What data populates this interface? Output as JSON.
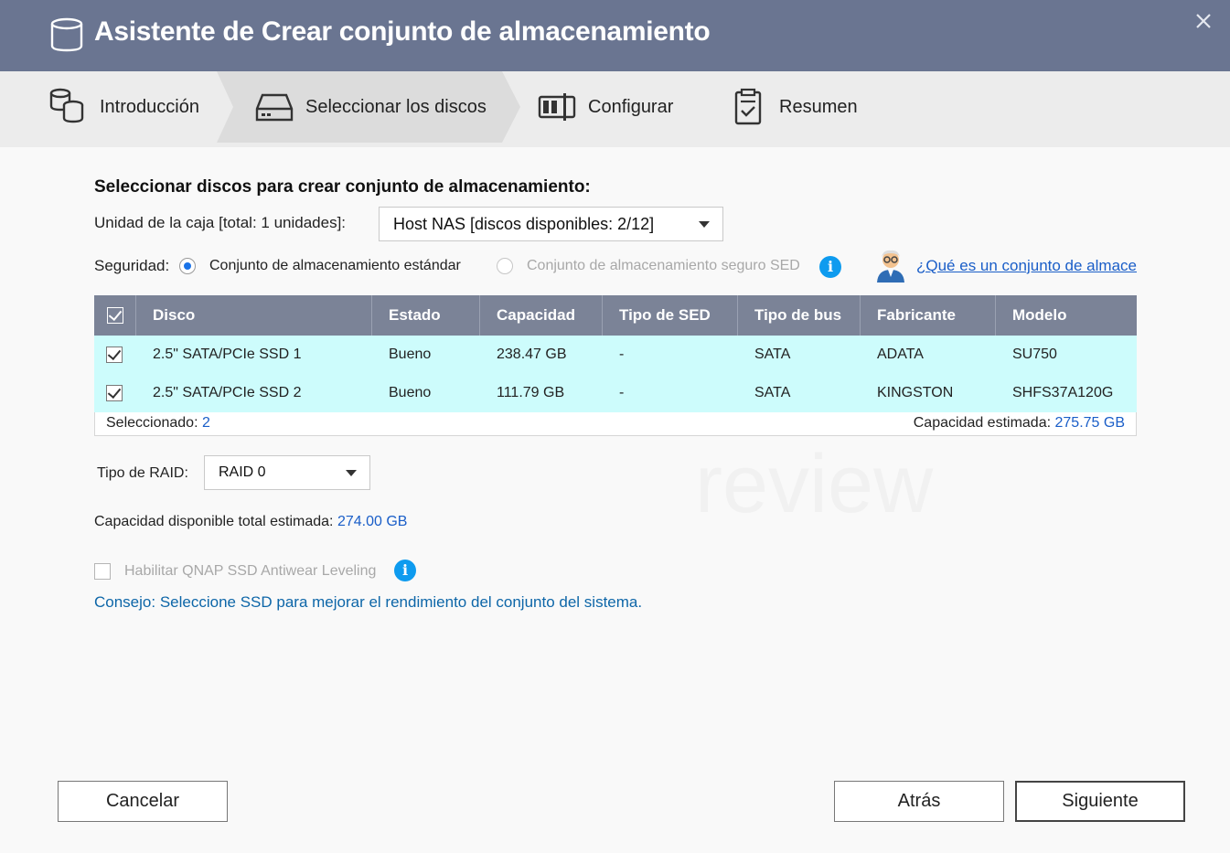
{
  "window": {
    "title": "Asistente de Crear conjunto de almacenamiento",
    "close_icon": "close-icon"
  },
  "steps": [
    {
      "label": "Introducción",
      "icon": "disks-icon"
    },
    {
      "label": "Seleccionar los discos",
      "icon": "drive-icon"
    },
    {
      "label": "Configurar",
      "icon": "config-icon"
    },
    {
      "label": "Resumen",
      "icon": "clipboard-icon"
    }
  ],
  "active_step": 1,
  "section": {
    "heading": "Seleccionar discos para crear conjunto de almacenamiento:",
    "enclosure_label": "Unidad de la caja [total: 1 unidades]:",
    "enclosure_value": "Host NAS [discos disponibles: 2/12]",
    "security_label": "Seguridad:",
    "security_option_standard": "Conjunto de almacenamiento estándar",
    "security_option_sed": "Conjunto de almacenamiento seguro SED",
    "help_link": "¿Qué es un conjunto de almacenamiento SED?"
  },
  "table": {
    "columns": [
      "Disco",
      "Estado",
      "Capacidad",
      "Tipo de SED",
      "Tipo de bus",
      "Fabricante",
      "Modelo"
    ],
    "rows": [
      [
        "2.5\" SATA/PCIe SSD 1",
        "Bueno",
        "238.47 GB",
        "-",
        "SATA",
        "ADATA",
        "SU750"
      ],
      [
        "2.5\" SATA/PCIe SSD 2",
        "Bueno",
        "111.79 GB",
        "-",
        "SATA",
        "KINGSTON",
        "SHFS37A120G"
      ]
    ],
    "selected_label": "Seleccionado:",
    "selected_count": "2",
    "capacity_label": "Capacidad estimada:",
    "capacity_value": "275.75 GB"
  },
  "raid": {
    "label": "Tipo de RAID:",
    "value": "RAID 0"
  },
  "total": {
    "label": "Capacidad disponible total estimada:",
    "value": "274.00 GB"
  },
  "antiwear": {
    "label": "Habilitar QNAP SSD Antiwear Leveling"
  },
  "tip": "Consejo: Seleccione SSD para mejorar el rendimiento del conjunto del sistema.",
  "buttons": {
    "cancel": "Cancelar",
    "back": "Atrás",
    "next": "Siguiente"
  },
  "colors": {
    "titlebar": "#6a7591",
    "table_header": "#7b8397",
    "row_highlight": "#cdfcfc",
    "link": "#1a5ec8",
    "info": "#0e9bef"
  }
}
